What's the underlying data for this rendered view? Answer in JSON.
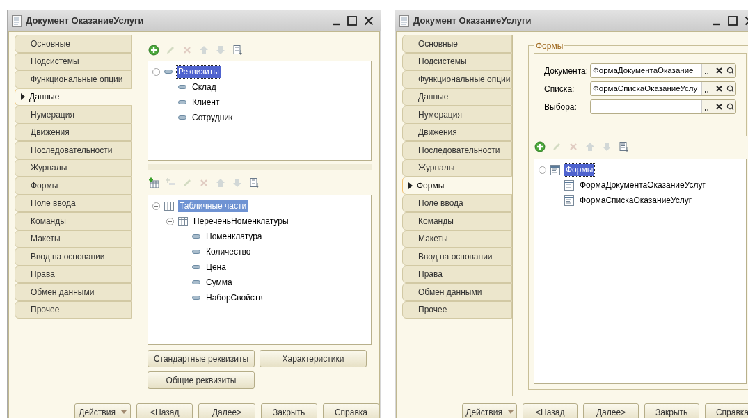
{
  "windows": [
    {
      "title": "Документ ОказаниеУслуги",
      "tabs": [
        {
          "label": "Основные",
          "selected": false
        },
        {
          "label": "Подсистемы",
          "selected": false
        },
        {
          "label": "Функциональные опции",
          "selected": false
        },
        {
          "label": "Данные",
          "selected": true
        },
        {
          "label": "Нумерация",
          "selected": false
        },
        {
          "label": "Движения",
          "selected": false
        },
        {
          "label": "Последовательности",
          "selected": false
        },
        {
          "label": "Журналы",
          "selected": false
        },
        {
          "label": "Формы",
          "selected": false
        },
        {
          "label": "Поле ввода",
          "selected": false
        },
        {
          "label": "Команды",
          "selected": false
        },
        {
          "label": "Макеты",
          "selected": false
        },
        {
          "label": "Ввод на основании",
          "selected": false
        },
        {
          "label": "Права",
          "selected": false
        },
        {
          "label": "Обмен данными",
          "selected": false
        },
        {
          "label": "Прочее",
          "selected": false
        }
      ],
      "content": {
        "kind": "data",
        "attributes": {
          "toolbar": [
            {
              "kind": "add",
              "disabled": false
            },
            {
              "kind": "edit",
              "disabled": true
            },
            {
              "kind": "delete",
              "disabled": true
            },
            {
              "kind": "up",
              "disabled": true
            },
            {
              "kind": "down",
              "disabled": true
            },
            {
              "kind": "list",
              "disabled": false
            }
          ],
          "tree": {
            "focused": true,
            "nodes": [
              {
                "label": "Реквизиты",
                "kind": "attribute",
                "selected": true,
                "expanded": true,
                "children": [
                  {
                    "label": "Склад",
                    "kind": "attribute",
                    "selected": false
                  },
                  {
                    "label": "Клиент",
                    "kind": "attribute",
                    "selected": false
                  },
                  {
                    "label": "Сотрудник",
                    "kind": "attribute",
                    "selected": false
                  }
                ]
              }
            ]
          }
        },
        "tabular_sections": {
          "toolbar": [
            {
              "kind": "add-table",
              "disabled": false
            },
            {
              "kind": "add-row",
              "disabled": true
            },
            {
              "kind": "edit",
              "disabled": true
            },
            {
              "kind": "delete",
              "disabled": true
            },
            {
              "kind": "up",
              "disabled": true
            },
            {
              "kind": "down",
              "disabled": true
            },
            {
              "kind": "list",
              "disabled": false
            }
          ],
          "tree": {
            "focused": false,
            "nodes": [
              {
                "label": "Табличные части",
                "kind": "table",
                "selected": true,
                "expanded": true,
                "children": [
                  {
                    "label": "ПереченьНоменклатуры",
                    "kind": "table",
                    "selected": false,
                    "expanded": true,
                    "children": [
                      {
                        "label": "Номенклатура",
                        "kind": "attribute",
                        "selected": false
                      },
                      {
                        "label": "Количество",
                        "kind": "attribute",
                        "selected": false
                      },
                      {
                        "label": "Цена",
                        "kind": "attribute",
                        "selected": false
                      },
                      {
                        "label": "Сумма",
                        "kind": "attribute",
                        "selected": false
                      },
                      {
                        "label": "НаборСвойств",
                        "kind": "attribute",
                        "selected": false
                      }
                    ]
                  }
                ]
              }
            ]
          }
        },
        "buttons": [
          "Стандартные реквизиты",
          "Характеристики",
          "Общие реквизиты"
        ]
      },
      "footer": [
        {
          "label": "Действия",
          "kind": "menu"
        },
        {
          "label": "<Назад",
          "kind": "plain"
        },
        {
          "label": "Далее>",
          "kind": "plain"
        },
        {
          "label": "Закрыть",
          "kind": "plain"
        },
        {
          "label": "Справка",
          "kind": "plain"
        }
      ]
    },
    {
      "title": "Документ ОказаниеУслуги",
      "tabs": [
        {
          "label": "Основные",
          "selected": false
        },
        {
          "label": "Подсистемы",
          "selected": false
        },
        {
          "label": "Функциональные опции",
          "selected": false
        },
        {
          "label": "Данные",
          "selected": false
        },
        {
          "label": "Нумерация",
          "selected": false
        },
        {
          "label": "Движения",
          "selected": false
        },
        {
          "label": "Последовательности",
          "selected": false
        },
        {
          "label": "Журналы",
          "selected": false
        },
        {
          "label": "Формы",
          "selected": true
        },
        {
          "label": "Поле ввода",
          "selected": false
        },
        {
          "label": "Команды",
          "selected": false
        },
        {
          "label": "Макеты",
          "selected": false
        },
        {
          "label": "Ввод на основании",
          "selected": false
        },
        {
          "label": "Права",
          "selected": false
        },
        {
          "label": "Обмен данными",
          "selected": false
        },
        {
          "label": "Прочее",
          "selected": false
        }
      ],
      "content": {
        "kind": "forms",
        "group": {
          "title": "Формы",
          "fields": [
            {
              "label": "Документа:",
              "value": "ФормаДокументаОказание"
            },
            {
              "label": "Списка:",
              "value": "ФормаСпискаОказаниеУслу"
            },
            {
              "label": "Выбора:"
            }
          ]
        },
        "toolbar": [
          {
            "kind": "add",
            "disabled": false
          },
          {
            "kind": "edit",
            "disabled": true
          },
          {
            "kind": "delete",
            "disabled": true
          },
          {
            "kind": "up",
            "disabled": true
          },
          {
            "kind": "down",
            "disabled": true
          },
          {
            "kind": "list",
            "disabled": false
          }
        ],
        "tree": {
          "focused": true,
          "nodes": [
            {
              "label": "Формы",
              "kind": "form",
              "selected": true,
              "expanded": true,
              "children": [
                {
                  "label": "ФормаДокументаОказаниеУслуг",
                  "kind": "form",
                  "selected": false
                },
                {
                  "label": "ФормаСпискаОказаниеУслуг",
                  "kind": "form",
                  "selected": false
                }
              ]
            }
          ]
        }
      },
      "footer": [
        {
          "label": "Действия",
          "kind": "menu"
        },
        {
          "label": "<Назад",
          "kind": "plain"
        },
        {
          "label": "Далее>",
          "kind": "plain"
        },
        {
          "label": "Закрыть",
          "kind": "plain"
        },
        {
          "label": "Справка",
          "kind": "plain"
        }
      ]
    }
  ]
}
